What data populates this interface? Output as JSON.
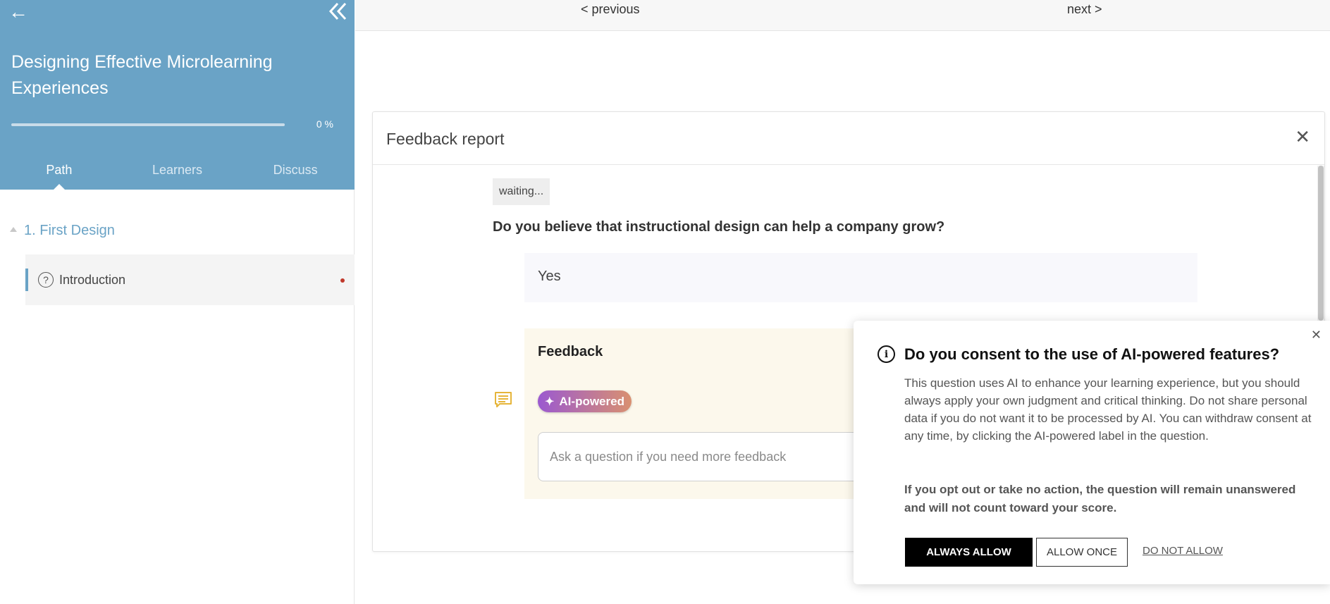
{
  "sidebar": {
    "back_icon": "left-arrow-icon",
    "collapse_icon": "double-chevron-left-icon",
    "course_title": "Designing Effective Microlearning Experiences",
    "progress_value": 0,
    "progress_text": "0 %",
    "tabs": [
      {
        "label": "Path",
        "active": true
      },
      {
        "label": "Learners",
        "active": false
      },
      {
        "label": "Discuss",
        "active": false
      }
    ],
    "section_label": "1. First Design",
    "lesson_label": "Introduction",
    "lesson_icon": "question-circle-icon",
    "accent_color": "#6aa3c6"
  },
  "topnav": {
    "previous_label": "< previous",
    "next_label": "next >"
  },
  "report": {
    "title": "Feedback report",
    "waiting_label": "waiting...",
    "question": "Do you believe that instructional design can help a company grow?",
    "answer": "Yes",
    "feedback_title": "Feedback",
    "ai_badge_label": "AI-powered",
    "ask_placeholder": "Ask a question if you need more feedback"
  },
  "consent": {
    "title": "Do you consent to the use of AI-powered features?",
    "body": "This question uses AI to enhance your learning experience, but you should always apply your own judgment and critical thinking. Do not share personal data if you do not want it to be processed by AI. You can withdraw consent at any time, by clicking the AI-powered label in the question.",
    "warning": "If you opt out or take no action, the question will remain unanswered and will not count toward your score.",
    "always_allow": "ALWAYS ALLOW",
    "allow_once": "ALLOW ONCE",
    "do_not_allow": "DO NOT ALLOW"
  }
}
